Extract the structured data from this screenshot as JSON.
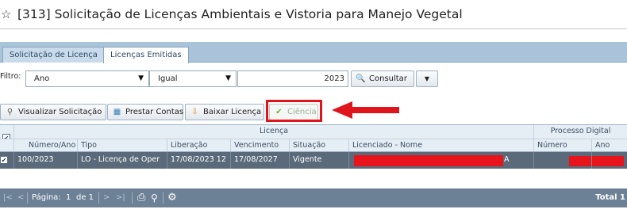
{
  "header": {
    "star_icon": "star-outline-icon",
    "title": "[313] Solicitação de Licenças Ambientais e Vistoria para Manejo Vegetal"
  },
  "tabs": [
    {
      "label": "Solicitação de Licença",
      "active": false
    },
    {
      "label": "Licenças Emitidas",
      "active": true
    }
  ],
  "filter": {
    "label": "Filtro:",
    "field_value": "Ano",
    "operator_value": "Igual",
    "value": "2023",
    "consultar_label": "Consultar"
  },
  "toolbar": {
    "visualizar_label": "Visualizar Solicitação",
    "prestar_label": "Prestar Contas",
    "baixar_label": "Baixar Licença",
    "ciencia_label": "Ciência"
  },
  "grid": {
    "group_headers": {
      "licenca": "Licença",
      "processo": "Processo Digital"
    },
    "columns": [
      "Número/Ano",
      "Tipo",
      "Liberação",
      "Vencimento",
      "Situação",
      "Licenciado - Nome",
      "Número",
      "Ano"
    ],
    "rows": [
      {
        "numero_ano": "100/2023",
        "tipo": "LO - Licença de Oper",
        "liberacao": "17/08/2023 12",
        "vencimento": "17/08/2027",
        "situacao": "Vigente",
        "nome_suffix": "A"
      }
    ]
  },
  "statusbar": {
    "page_label": "Página:",
    "page_number": "1",
    "of_label": "de 1",
    "total_label": "Total 1"
  },
  "colors": {
    "highlight": "#e0141b",
    "selected_row": "#5a6a7a",
    "tab_strip": "#a9c3d9"
  }
}
